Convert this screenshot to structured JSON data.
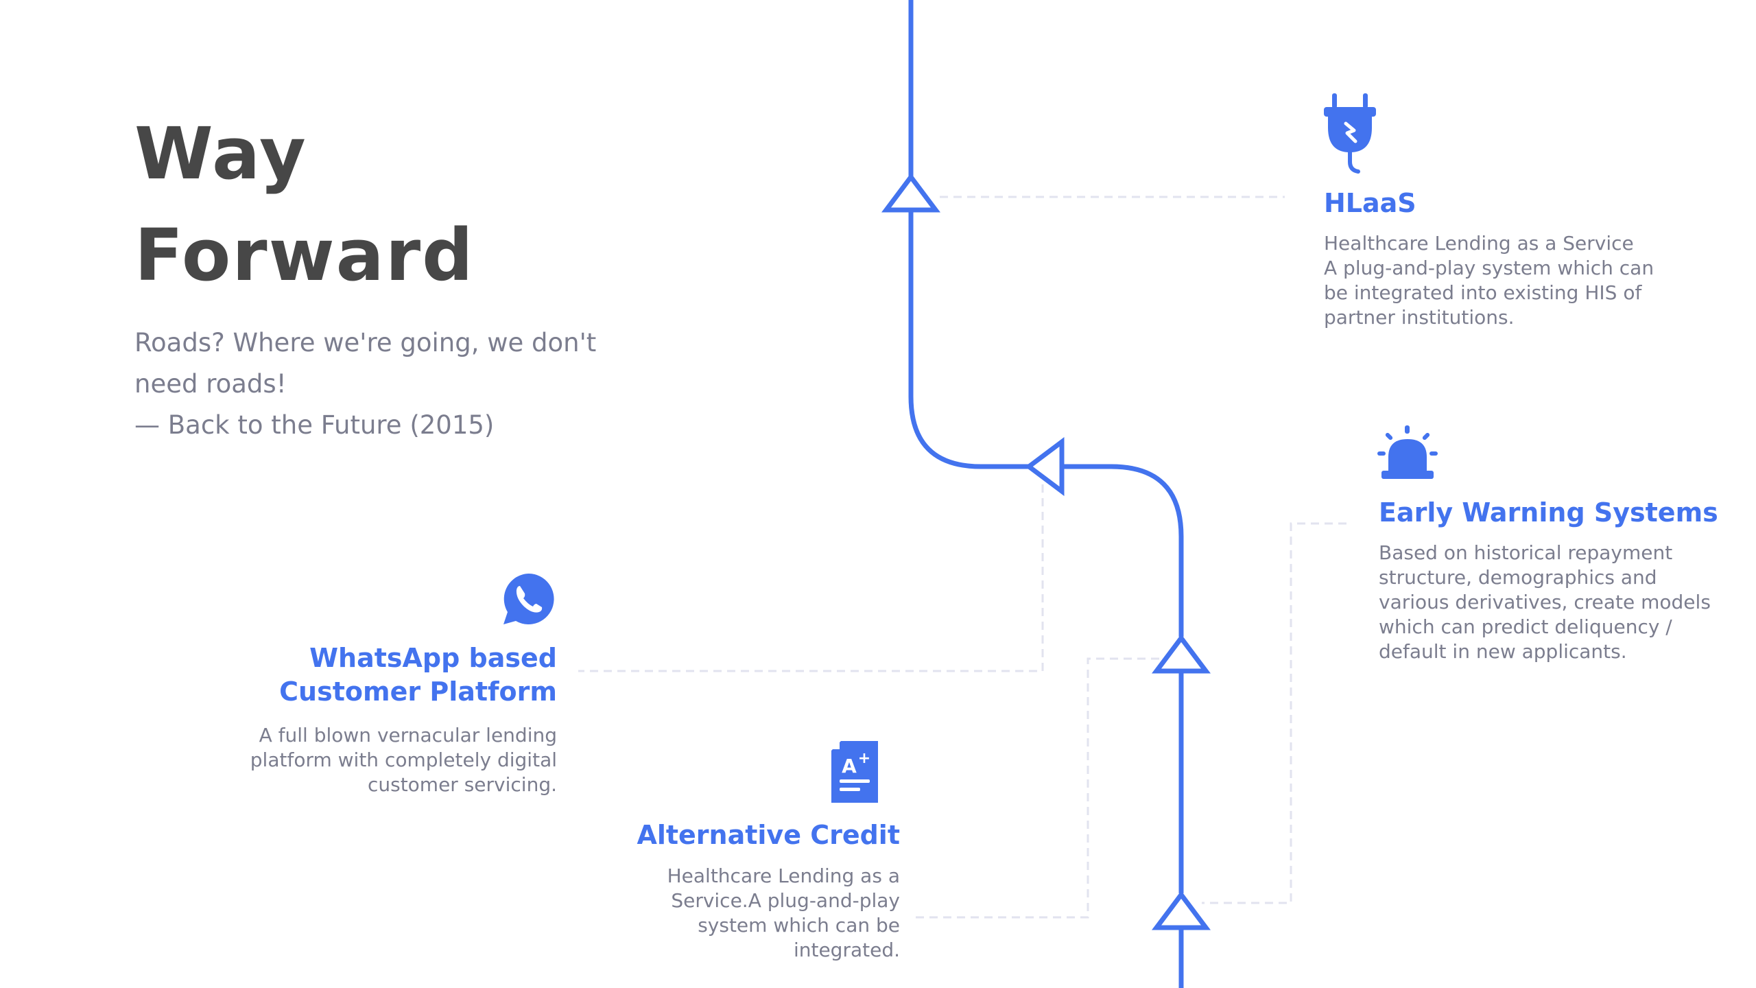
{
  "title": {
    "line1": "Way",
    "line2": "Forward"
  },
  "quote": {
    "line1": "Roads? Where we're going, we don't",
    "line2": "need roads!",
    "attribution": "— Back to the Future (2015)"
  },
  "colors": {
    "accent": "#4373ee",
    "title": "#474747",
    "body": "#7b7d8e",
    "dashed": "#e2e3ef"
  },
  "nodes": {
    "hlaas": {
      "icon": "plug-icon",
      "title": "HLaaS",
      "desc": [
        "Healthcare Lending as a Service",
        "A plug-and-play system which can",
        "be integrated into existing HIS of",
        "partner institutions."
      ]
    },
    "early_warning": {
      "icon": "siren-icon",
      "title": "Early Warning Systems",
      "desc": [
        "Based on historical repayment",
        "structure, demographics and",
        "various derivatives, create models",
        "which can predict deliquency /",
        "default in new applicants."
      ]
    },
    "whatsapp": {
      "icon": "whatsapp-icon",
      "title_line1": "WhatsApp based",
      "title_line2": "Customer Platform",
      "desc": [
        "A full blown vernacular lending",
        "platform with completely digital",
        "customer servicing."
      ]
    },
    "alt_credit": {
      "icon": "credit-document-icon",
      "title": "Alternative Credit",
      "desc": [
        "Healthcare Lending as a",
        "Service.A plug-and-play",
        "system which can be",
        "integrated."
      ]
    }
  }
}
